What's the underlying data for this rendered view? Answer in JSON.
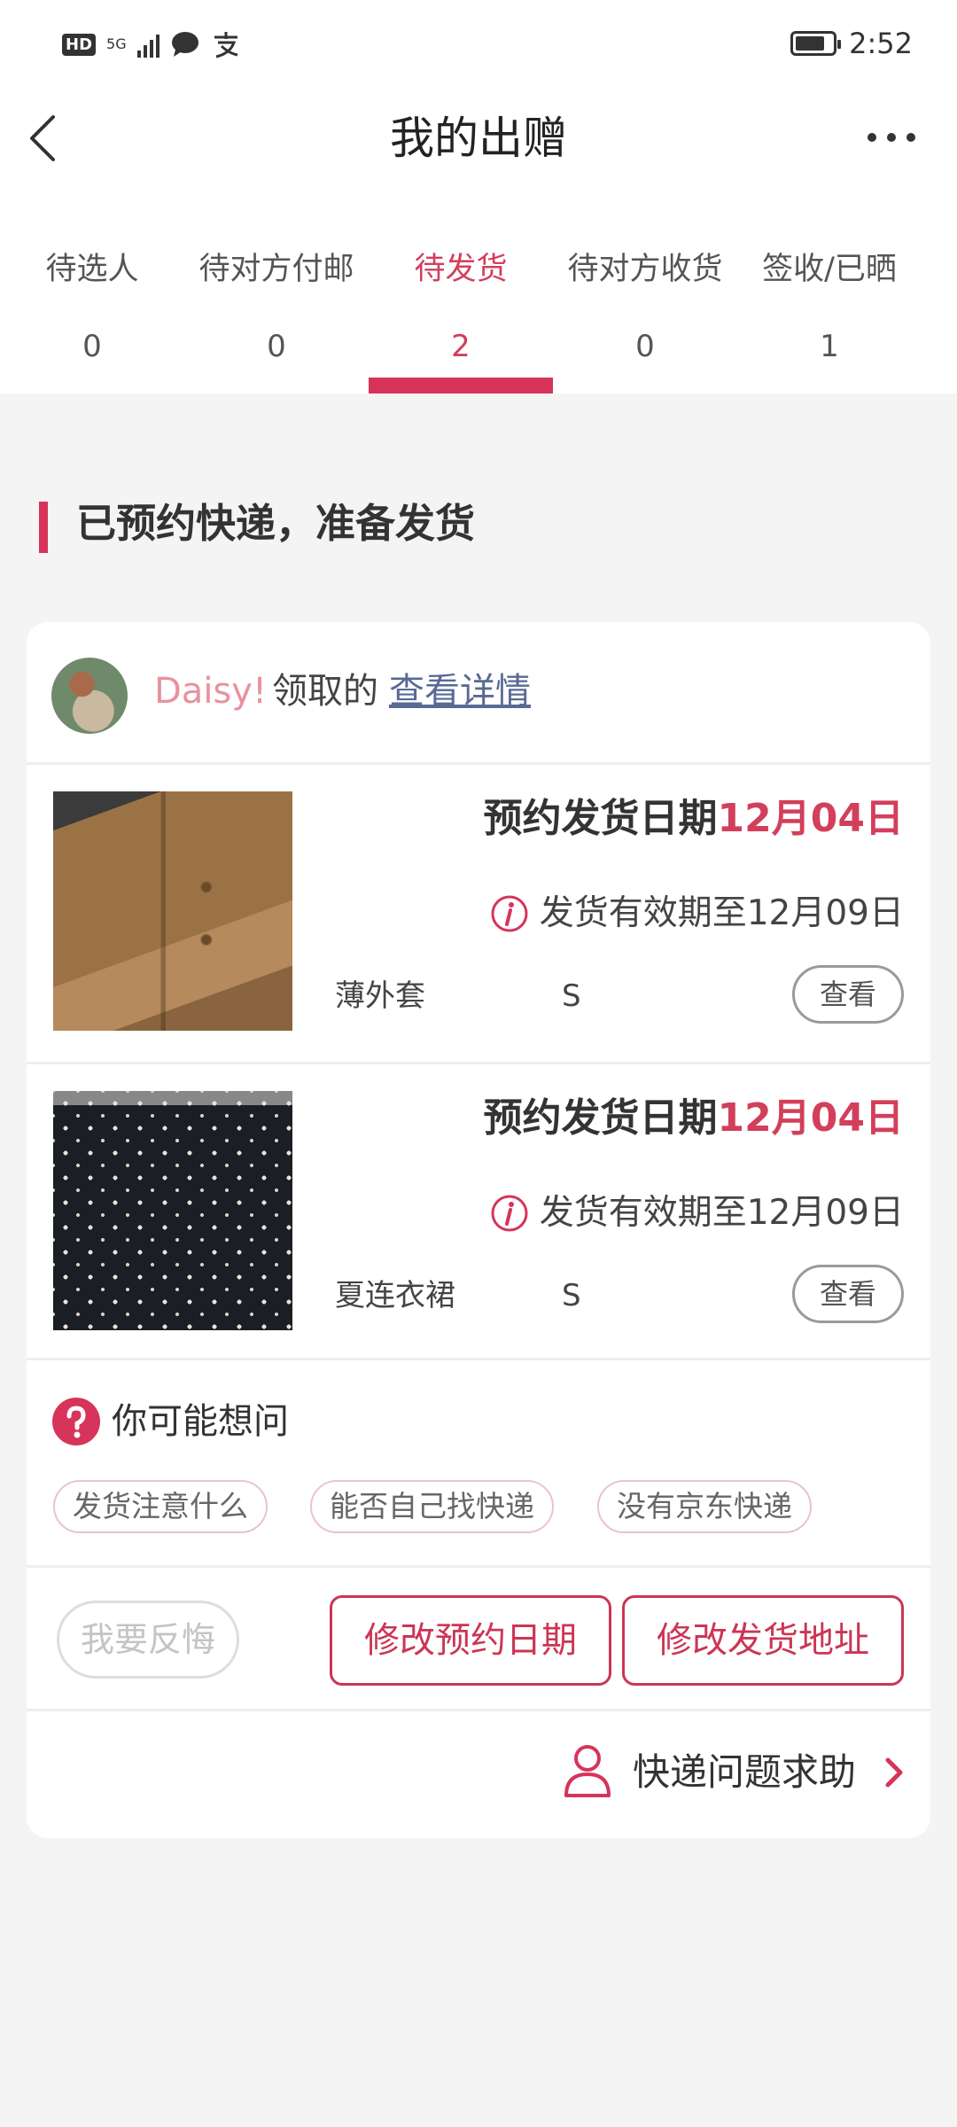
{
  "status_bar": {
    "hd": "HD",
    "network": "5G",
    "time": "2:52",
    "battery_level": 0.8,
    "icons": [
      "hd-badge",
      "signal-icon",
      "message-icon",
      "alipay-icon",
      "battery-icon"
    ]
  },
  "header": {
    "title": "我的出赠",
    "back_icon": "chevron-left-icon",
    "more_icon": "more-dots-icon"
  },
  "tabs": [
    {
      "label": "待选人",
      "count": "0",
      "active": false
    },
    {
      "label": "待对方付邮",
      "count": "0",
      "active": false
    },
    {
      "label": "待发货",
      "count": "2",
      "active": true
    },
    {
      "label": "待对方收货",
      "count": "0",
      "active": false
    },
    {
      "label": "签收/已晒",
      "count": "1",
      "active": false
    }
  ],
  "section": {
    "title": "已预约快递，准备发货"
  },
  "card": {
    "giver": {
      "name": "Daisy!",
      "action": "领取的",
      "detail_link": "查看详情"
    },
    "items": [
      {
        "image": "brown-jacket-photo",
        "ship_label": "预约发货日期",
        "ship_date": "12月04日",
        "validity": "发货有效期至12月09日",
        "name": "薄外套",
        "size": "S",
        "view_label": "查看"
      },
      {
        "image": "floral-dress-photo",
        "ship_label": "预约发货日期",
        "ship_date": "12月04日",
        "validity": "发货有效期至12月09日",
        "name": "夏连衣裙",
        "size": "S",
        "view_label": "查看"
      }
    ],
    "faq": {
      "title": "你可能想问",
      "chips": [
        "发货注意什么",
        "能否自己找快递",
        "没有京东快递"
      ]
    },
    "actions": {
      "regret": "我要反悔",
      "change_date": "修改预约日期",
      "change_address": "修改发货地址"
    },
    "support": {
      "label": "快递问题求助"
    }
  },
  "colors": {
    "accent": "#d6345a",
    "accent_text": "#d23f5b",
    "giver_name": "#e8929e",
    "link": "#586a94",
    "background": "#f4f4f4"
  }
}
